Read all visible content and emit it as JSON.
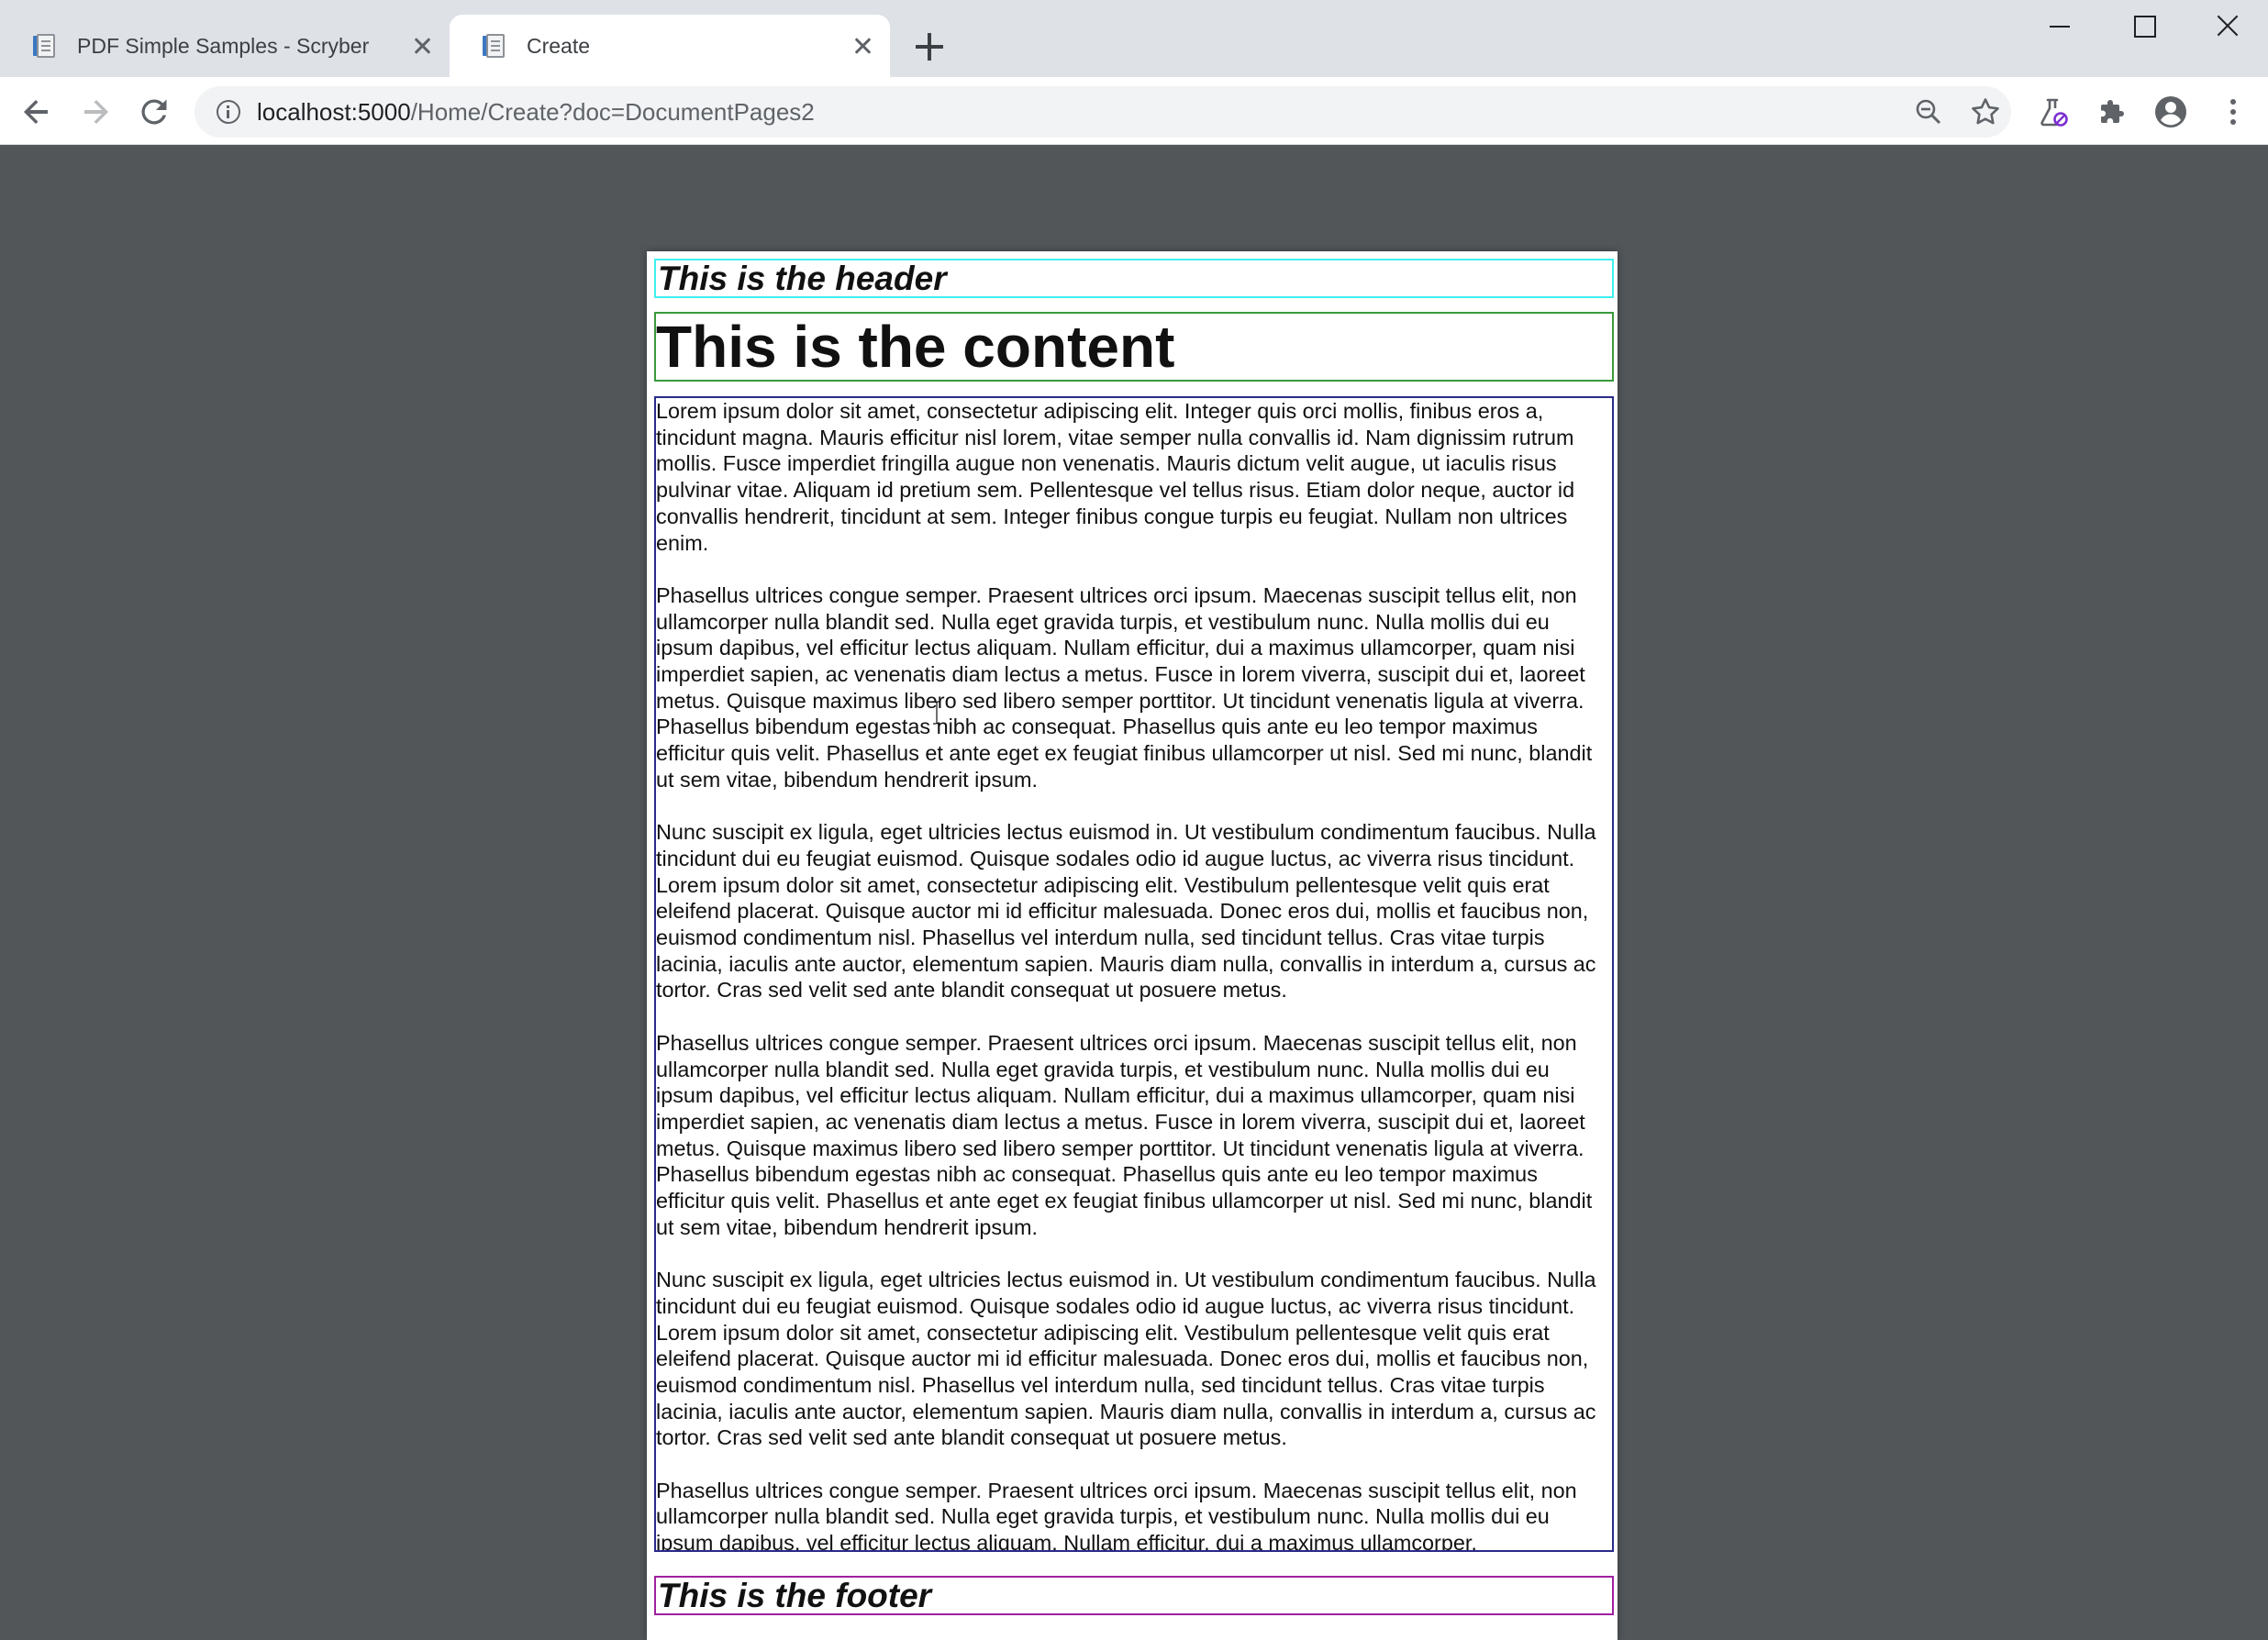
{
  "browser": {
    "tabs": [
      {
        "title": "PDF Simple Samples - Scryber",
        "active": false
      },
      {
        "title": "Create",
        "active": true
      }
    ],
    "url_host": "localhost:5000",
    "url_path": "/Home/Create?doc=DocumentPages2"
  },
  "document": {
    "header": "This is the header",
    "content_heading": "This is the content",
    "paragraphs": [
      "Lorem ipsum dolor sit amet, consectetur adipiscing elit. Integer quis orci mollis, finibus eros a, tincidunt magna. Mauris efficitur nisl lorem, vitae semper nulla convallis id. Nam dignissim rutrum mollis. Fusce imperdiet fringilla augue non venenatis. Mauris dictum velit augue, ut iaculis risus pulvinar vitae. Aliquam id pretium sem. Pellentesque vel tellus risus. Etiam dolor neque, auctor id convallis hendrerit, tincidunt at sem. Integer finibus congue turpis eu feugiat. Nullam non ultrices enim.",
      "Phasellus ultrices congue semper. Praesent ultrices orci ipsum. Maecenas suscipit tellus elit, non ullamcorper nulla blandit sed. Nulla eget gravida turpis, et vestibulum nunc. Nulla mollis dui eu ipsum dapibus, vel efficitur lectus aliquam. Nullam efficitur, dui a maximus ullamcorper, quam nisi imperdiet sapien, ac venenatis diam lectus a metus. Fusce in lorem viverra, suscipit dui et, laoreet metus. Quisque maximus libero sed libero semper porttitor. Ut tincidunt venenatis ligula at viverra. Phasellus bibendum egestas nibh ac consequat. Phasellus quis ante eu leo tempor maximus efficitur quis velit. Phasellus et ante eget ex feugiat finibus ullamcorper ut nisl. Sed mi nunc, blandit ut sem vitae, bibendum hendrerit ipsum.",
      "Nunc suscipit ex ligula, eget ultricies lectus euismod in. Ut vestibulum condimentum faucibus. Nulla tincidunt dui eu feugiat euismod. Quisque sodales odio id augue luctus, ac viverra risus tincidunt. Lorem ipsum dolor sit amet, consectetur adipiscing elit. Vestibulum pellentesque velit quis erat eleifend placerat. Quisque auctor mi id efficitur malesuada. Donec eros dui, mollis et faucibus non, euismod condimentum nisl. Phasellus vel interdum nulla, sed tincidunt tellus. Cras vitae turpis lacinia, iaculis ante auctor, elementum sapien. Mauris diam nulla, convallis in interdum a, cursus ac tortor. Cras sed velit sed ante blandit consequat ut posuere metus.",
      "Phasellus ultrices congue semper. Praesent ultrices orci ipsum. Maecenas suscipit tellus elit, non ullamcorper nulla blandit sed. Nulla eget gravida turpis, et vestibulum nunc. Nulla mollis dui eu ipsum dapibus, vel efficitur lectus aliquam. Nullam efficitur, dui a maximus ullamcorper, quam nisi imperdiet sapien, ac venenatis diam lectus a metus. Fusce in lorem viverra, suscipit dui et, laoreet metus. Quisque maximus libero sed libero semper porttitor. Ut tincidunt venenatis ligula at viverra. Phasellus bibendum egestas nibh ac consequat. Phasellus quis ante eu leo tempor maximus efficitur quis velit. Phasellus et ante eget ex feugiat finibus ullamcorper ut nisl. Sed mi nunc, blandit ut sem vitae, bibendum hendrerit ipsum.",
      "Nunc suscipit ex ligula, eget ultricies lectus euismod in. Ut vestibulum condimentum faucibus. Nulla tincidunt dui eu feugiat euismod. Quisque sodales odio id augue luctus, ac viverra risus tincidunt. Lorem ipsum dolor sit amet, consectetur adipiscing elit. Vestibulum pellentesque velit quis erat eleifend placerat. Quisque auctor mi id efficitur malesuada. Donec eros dui, mollis et faucibus non, euismod condimentum nisl. Phasellus vel interdum nulla, sed tincidunt tellus. Cras vitae turpis lacinia, iaculis ante auctor, elementum sapien. Mauris diam nulla, convallis in interdum a, cursus ac tortor. Cras sed velit sed ante blandit consequat ut posuere metus.",
      "Phasellus ultrices congue semper. Praesent ultrices orci ipsum. Maecenas suscipit tellus elit, non ullamcorper nulla blandit sed. Nulla eget gravida turpis, et vestibulum nunc. Nulla mollis dui eu ipsum dapibus, vel efficitur lectus aliquam. Nullam efficitur, dui a maximus ullamcorper,"
    ],
    "footer": "This is the footer"
  },
  "colors": {
    "header_border": "#3ff0ef",
    "content_border": "#3a9a3a",
    "body_border": "#2a2a8a",
    "footer_border": "#a020a0",
    "viewer_background": "#525659"
  },
  "icons": [
    "back-arrow-icon",
    "forward-arrow-icon",
    "reload-icon",
    "info-icon",
    "zoom-out-icon",
    "star-icon",
    "labs-flask-icon",
    "extensions-puzzle-icon",
    "profile-avatar-icon",
    "menu-kebab-icon",
    "tab-favicon-document-icon",
    "tab-close-icon",
    "new-tab-plus-icon",
    "minimize-icon",
    "maximize-icon",
    "close-window-icon"
  ]
}
